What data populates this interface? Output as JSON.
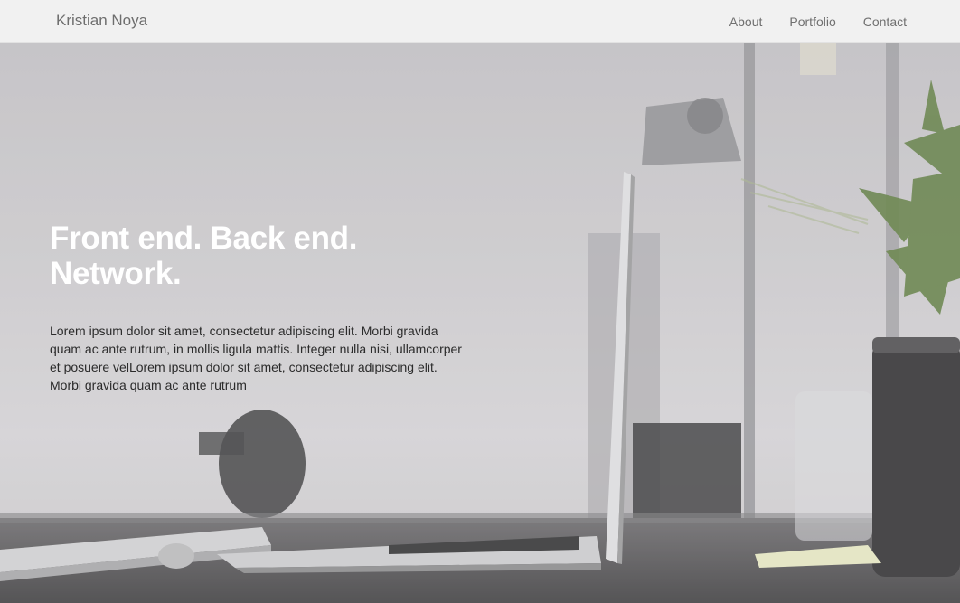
{
  "nav": {
    "brand": "Kristian Noya",
    "links": [
      "About",
      "Portfolio",
      "Contact"
    ]
  },
  "hero": {
    "title": "Front end. Back end. Network.",
    "text": "Lorem ipsum dolor sit amet, consectetur adipiscing elit. Morbi gravida quam ac ante rutrum, in mollis ligula mattis. Integer nulla nisi, ullamcorper et posuere velLorem ipsum dolor sit amet, consectetur adipiscing elit. Morbi gravida quam ac ante rutrum"
  },
  "colors": {
    "navbar_bg": "#f1f1f1",
    "nav_text": "#707070",
    "hero_title": "#ffffff",
    "hero_text": "#2b2b2b"
  }
}
